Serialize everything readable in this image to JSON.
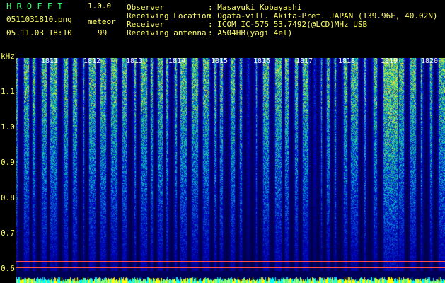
{
  "app": {
    "name": "H R O F F T",
    "version": "1.0.0",
    "filename": "0511031810.png",
    "datetime": "05.11.03 18:10",
    "meteor_label": "meteor",
    "meteor_count": "99"
  },
  "station": {
    "observer_label": "Observer",
    "observer_value": ": Masayuki Kobayashi",
    "location_label": "Receiving Location",
    "location_value": ": Ogata-vill. Akita-Pref. JAPAN (139.96E, 40.02N)",
    "receiver_label": "Receiver",
    "receiver_value": ": ICOM IC-575 53.7492(@LCD)MHz USB",
    "antenna_label": "Receiving antenna",
    "antenna_value": ": A504HB(yagi 4el)"
  },
  "axis": {
    "y_unit": "kHz",
    "y_ticks": [
      "1.1",
      "1.0",
      "0.9",
      "0.8",
      "0.7",
      "0.6"
    ],
    "time_ticks": [
      "1811",
      "1812",
      "1813",
      "1814",
      "1815",
      "1816",
      "1817",
      "1818",
      "1819",
      "1820"
    ]
  },
  "colors": {
    "text": "#ffff66",
    "logo": "#33ff66",
    "marker_line": "#ff4d4d",
    "background": "#000000"
  }
}
